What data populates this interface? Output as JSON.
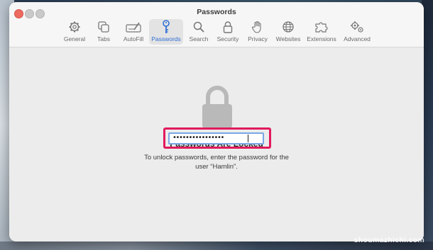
{
  "window": {
    "title": "Passwords"
  },
  "toolbar": {
    "tabs": [
      {
        "label": "General",
        "icon": "gear-icon"
      },
      {
        "label": "Tabs",
        "icon": "tabs-icon"
      },
      {
        "label": "AutoFill",
        "icon": "autofill-icon"
      },
      {
        "label": "Passwords",
        "icon": "key-icon",
        "selected": true
      },
      {
        "label": "Search",
        "icon": "search-icon"
      },
      {
        "label": "Security",
        "icon": "lock-icon"
      },
      {
        "label": "Privacy",
        "icon": "hand-icon"
      },
      {
        "label": "Websites",
        "icon": "globe-icon"
      },
      {
        "label": "Extensions",
        "icon": "puzzle-icon"
      },
      {
        "label": "Advanced",
        "icon": "gears-icon"
      }
    ]
  },
  "locked": {
    "title": "Passwords Are Locked",
    "message": "To unlock passwords, enter the password for the user “Hamlin”.",
    "password_value": "••••••••••••••••"
  },
  "watermark": "shoumazhichi.com",
  "colors": {
    "accent": "#2f6fd6",
    "highlight": "#e11a5d",
    "close": "#ed6a5e"
  }
}
